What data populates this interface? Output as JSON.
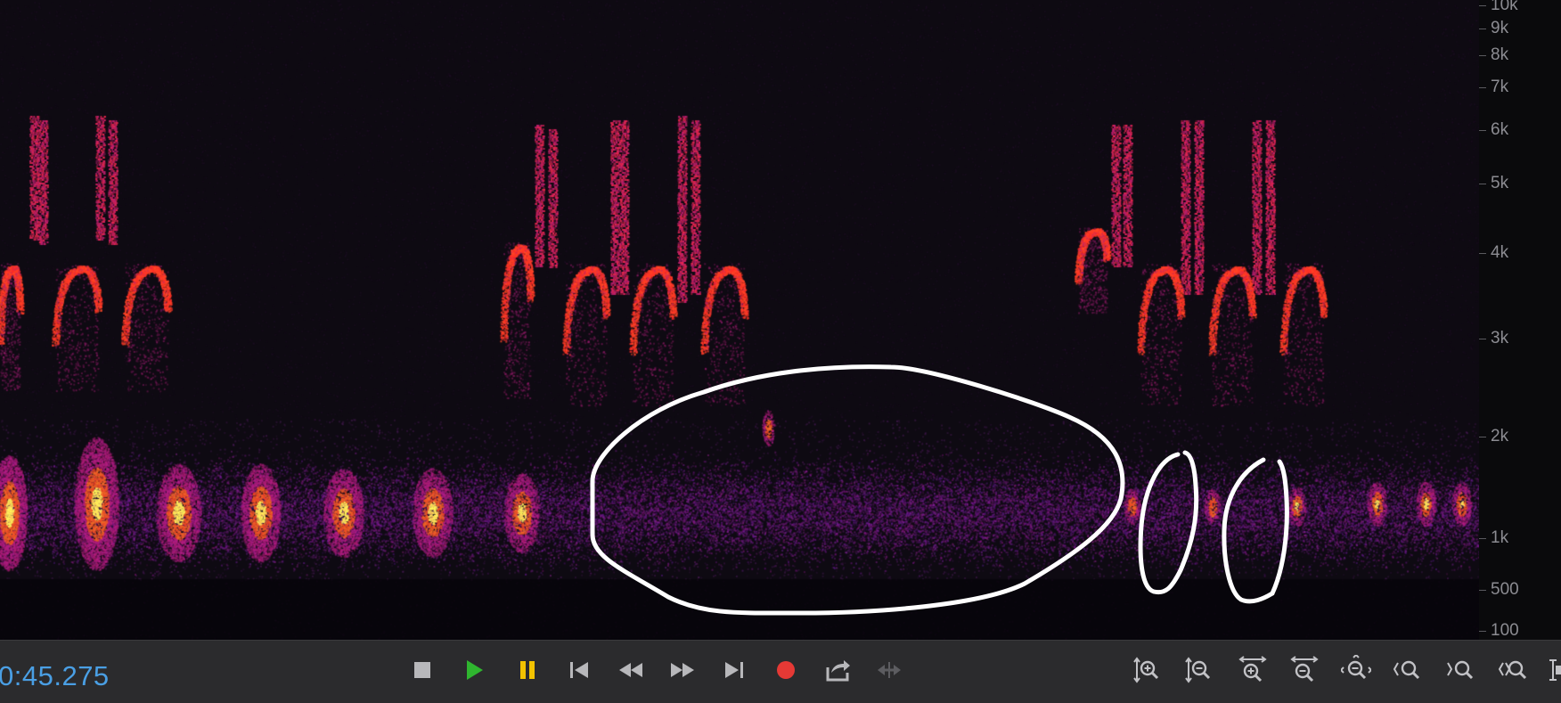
{
  "spectrogram": {
    "frequency_axis": {
      "labels": [
        "10k",
        "9k",
        "8k",
        "7k",
        "6k",
        "5k",
        "4k",
        "3k",
        "2k",
        "1k",
        "500",
        "100"
      ],
      "scale": "log"
    },
    "annotations": {
      "color": "#ffffff",
      "shapes": [
        "large-ellipse",
        "small-ellipse",
        "small-ellipse"
      ]
    }
  },
  "toolbar": {
    "timecode": "0:45.275",
    "transport": [
      {
        "name": "stop-button",
        "icon": "stop-icon",
        "color": "#b8b8bb"
      },
      {
        "name": "play-button",
        "icon": "play-icon",
        "color": "#2fb52f"
      },
      {
        "name": "pause-button",
        "icon": "pause-icon",
        "color": "#f2c200"
      },
      {
        "name": "skip-to-start-button",
        "icon": "skip-start-icon",
        "color": "#b8b8bb"
      },
      {
        "name": "rewind-button",
        "icon": "rewind-icon",
        "color": "#b8b8bb"
      },
      {
        "name": "fast-forward-button",
        "icon": "fast-forward-icon",
        "color": "#b8b8bb"
      },
      {
        "name": "skip-to-end-button",
        "icon": "skip-end-icon",
        "color": "#b8b8bb"
      },
      {
        "name": "record-button",
        "icon": "record-icon",
        "color": "#e53935"
      },
      {
        "name": "export-button",
        "icon": "export-icon",
        "color": "#b8b8bb"
      },
      {
        "name": "loop-button",
        "icon": "loop-icon",
        "color": "#5c5c60",
        "disabled": true
      }
    ],
    "zoom": [
      {
        "name": "zoom-in-amplitude-button",
        "icon": "zoom-in-vertical-icon"
      },
      {
        "name": "zoom-out-amplitude-button",
        "icon": "zoom-out-vertical-icon"
      },
      {
        "name": "zoom-in-time-button",
        "icon": "zoom-in-horizontal-icon"
      },
      {
        "name": "zoom-out-time-button",
        "icon": "zoom-out-horizontal-icon"
      },
      {
        "name": "zoom-out-full-button",
        "icon": "zoom-full-icon"
      },
      {
        "name": "zoom-to-selection-start-button",
        "icon": "zoom-selection-in-icon"
      },
      {
        "name": "zoom-to-selection-end-button",
        "icon": "zoom-selection-out-icon"
      },
      {
        "name": "zoom-to-selection-button",
        "icon": "zoom-selection-icon"
      },
      {
        "name": "spectral-selection-button",
        "icon": "spectral-select-icon"
      }
    ]
  }
}
